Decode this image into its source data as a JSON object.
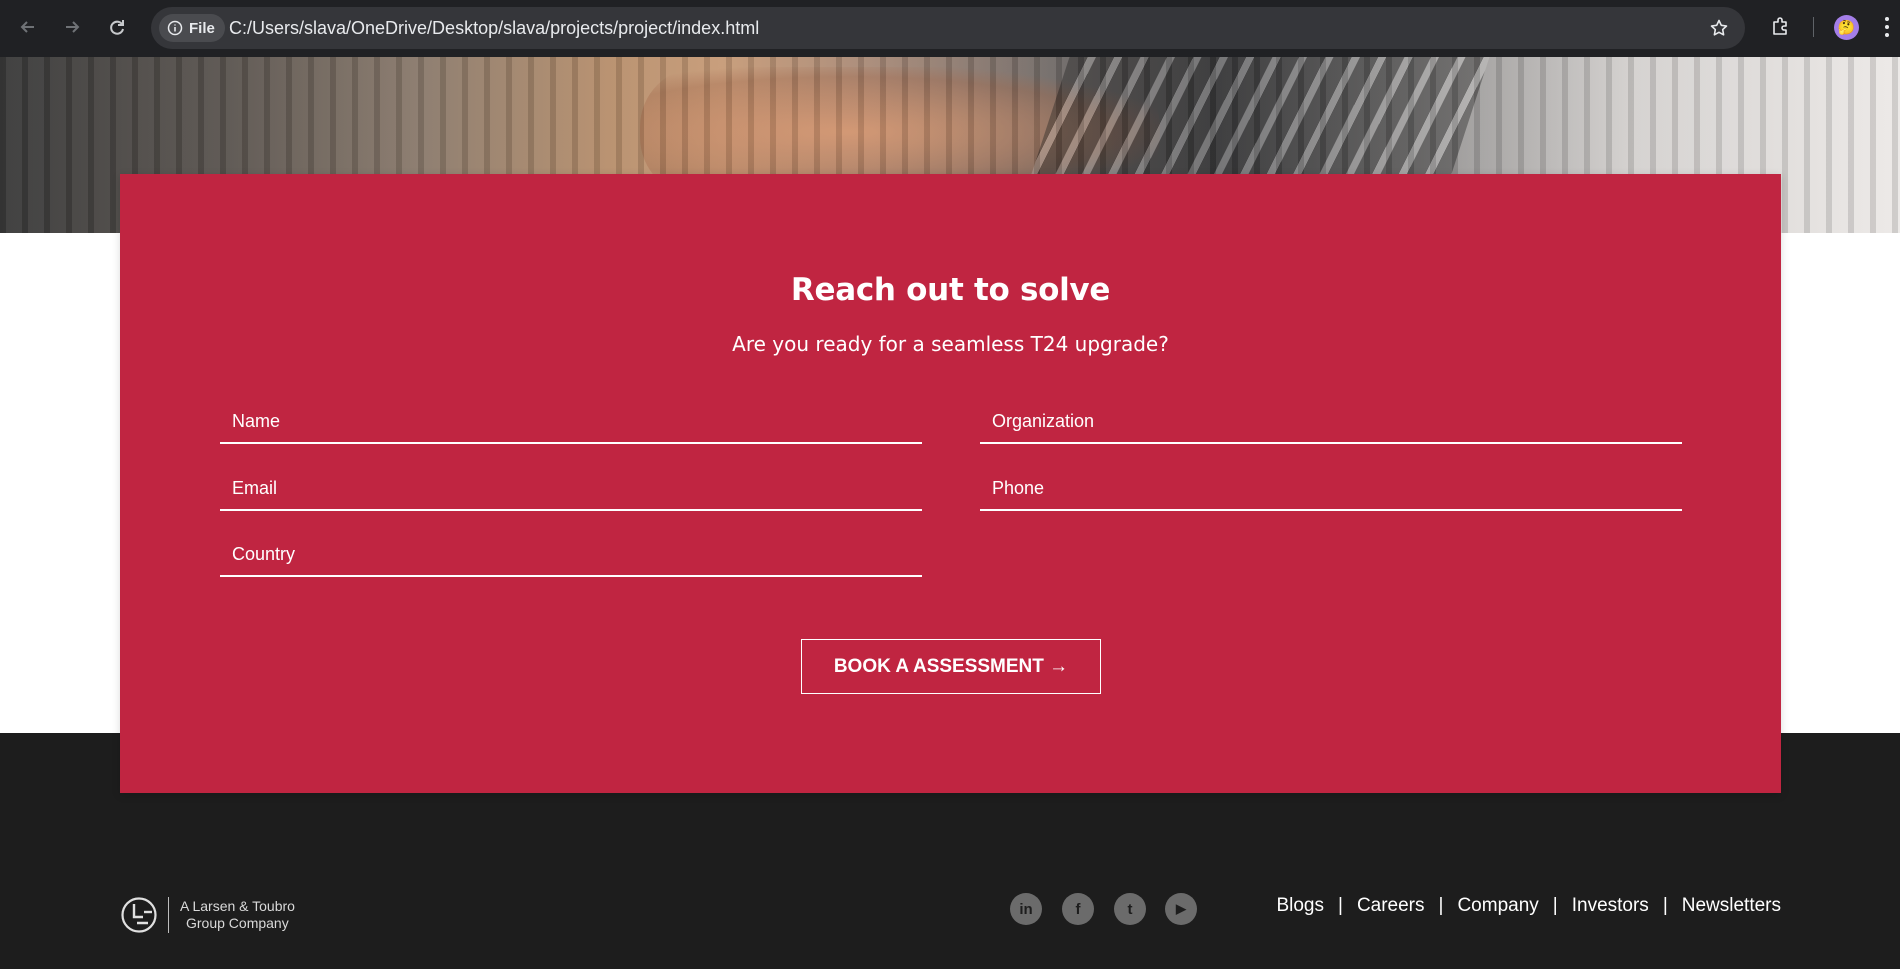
{
  "browser": {
    "url": "C:/Users/slava/OneDrive/Desktop/slava/projects/project/index.html",
    "file_chip": "File",
    "avatar_glyph": "🤔"
  },
  "contact": {
    "title": "Reach out to solve",
    "subtitle": "Are you ready for a seamless T24 upgrade?",
    "fields": {
      "name": "Name",
      "organization": "Organization",
      "email": "Email",
      "phone": "Phone",
      "country": "Country"
    },
    "cta_label": "BOOK A ASSESSMENT →"
  },
  "footer": {
    "logo_line1": "A Larsen & Toubro",
    "logo_line2": "Group Company",
    "social": {
      "linkedin": "in",
      "facebook": "f",
      "twitter": "t",
      "youtube": "▶"
    },
    "links": [
      "Blogs",
      "Careers",
      "Company",
      "Investors",
      "Newsletters"
    ],
    "separator": "|"
  },
  "colors": {
    "brand_red": "#c02541",
    "footer_bg": "#1d1d1d",
    "chrome_bg": "#202124"
  }
}
